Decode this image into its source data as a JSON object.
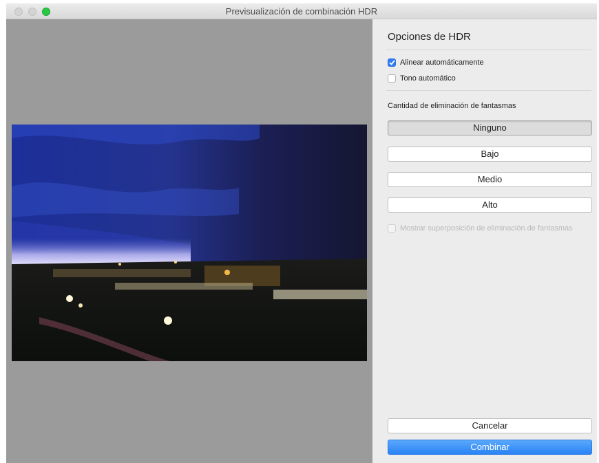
{
  "window": {
    "title": "Previsualización de combinación HDR"
  },
  "panel": {
    "title": "Opciones de HDR",
    "auto_align": {
      "label": "Alinear automáticamente",
      "checked": true
    },
    "auto_tone": {
      "label": "Tono automático",
      "checked": false
    },
    "deghost_label": "Cantidad de eliminación de fantasmas",
    "deghost_options": [
      "Ninguno",
      "Bajo",
      "Medio",
      "Alto"
    ],
    "deghost_selected": "Ninguno",
    "overlay": {
      "label": "Mostrar superposición de eliminación de fantasmas",
      "checked": false,
      "enabled": false
    }
  },
  "actions": {
    "cancel_label": "Cancelar",
    "merge_label": "Combinar"
  },
  "colors": {
    "accent": "#2f7cf6",
    "preview_bg": "#9b9b9b",
    "panel_bg": "#ececec"
  }
}
